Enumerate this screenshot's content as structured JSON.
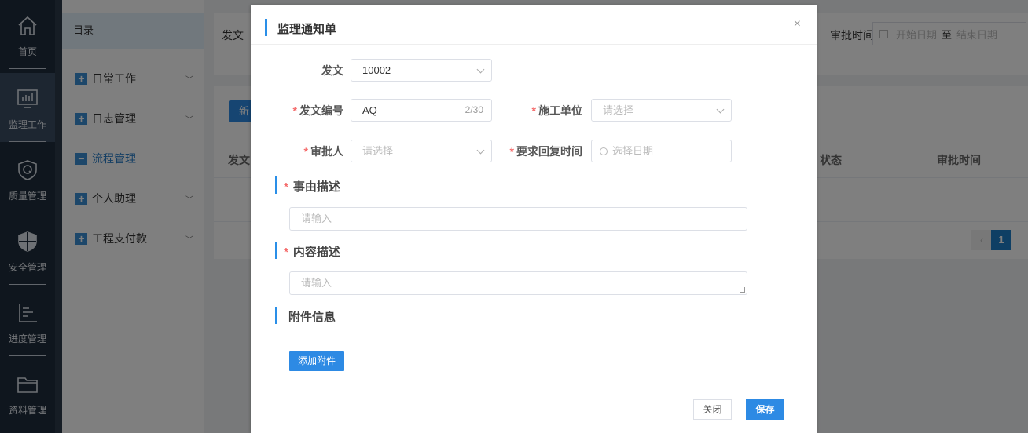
{
  "nav": {
    "items": [
      {
        "label": "首页",
        "icon": "home-icon"
      },
      {
        "label": "监理工作",
        "icon": "monitor-chart-icon"
      },
      {
        "label": "质量管理",
        "icon": "quality-shield-icon"
      },
      {
        "label": "安全管理",
        "icon": "safety-shield-icon"
      },
      {
        "label": "进度管理",
        "icon": "progress-chart-icon"
      },
      {
        "label": "资料管理",
        "icon": "folder-icon"
      }
    ]
  },
  "sidebar": {
    "header": "目录",
    "items": [
      {
        "label": "日常工作"
      },
      {
        "label": "日志管理"
      },
      {
        "label": "流程管理"
      },
      {
        "label": "个人助理"
      },
      {
        "label": "工程支付款"
      }
    ]
  },
  "background": {
    "filter_label": "发文",
    "approve_time_label": "审批时间",
    "start_date_placeholder": "开始日期",
    "range_separator": "至",
    "end_date_placeholder": "结束日期",
    "new_button_label": "新",
    "columns": [
      "发文",
      "状态",
      "审批时间"
    ],
    "pager": {
      "prev": "‹",
      "current": "1"
    }
  },
  "dialog": {
    "title": "监理通知单",
    "close_symbol": "×",
    "fields": {
      "fawen": {
        "label": "发文",
        "value": "10002"
      },
      "fawen_no": {
        "label": "发文编号",
        "value": "AQ",
        "counter": "2/30"
      },
      "construction_unit": {
        "label": "施工单位",
        "placeholder": "请选择"
      },
      "approver": {
        "label": "审批人",
        "placeholder": "请选择"
      },
      "reply_time": {
        "label": "要求回复时间",
        "placeholder": "选择日期"
      }
    },
    "sections": {
      "reason": {
        "title": "事由描述",
        "placeholder": "请输入"
      },
      "content": {
        "title": "内容描述",
        "placeholder": "请输入"
      },
      "attachment": {
        "title": "附件信息",
        "button": "添加附件"
      }
    },
    "required_mark": "*",
    "buttons": {
      "close": "关闭",
      "save": "保存"
    }
  }
}
